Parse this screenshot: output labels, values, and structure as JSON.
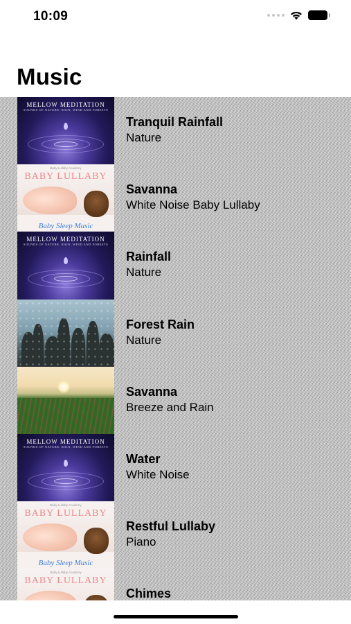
{
  "status_bar": {
    "time": "10:09"
  },
  "page": {
    "title": "Music"
  },
  "tracks": [
    {
      "title": "Tranquil Rainfall",
      "subtitle": "Nature",
      "art": "mellow-meditation"
    },
    {
      "title": "Savanna",
      "subtitle": "White Noise Baby Lullaby",
      "art": "baby-lullaby"
    },
    {
      "title": "Rainfall",
      "subtitle": "Nature",
      "art": "mellow-meditation"
    },
    {
      "title": "Forest Rain",
      "subtitle": "Nature",
      "art": "forest-rain"
    },
    {
      "title": "Savanna",
      "subtitle": "Breeze and Rain",
      "art": "sunrise-field"
    },
    {
      "title": "Water",
      "subtitle": "White Noise",
      "art": "mellow-meditation"
    },
    {
      "title": "Restful Lullaby",
      "subtitle": "Piano",
      "art": "baby-lullaby"
    },
    {
      "title": "Chimes",
      "subtitle": "",
      "art": "baby-lullaby"
    }
  ],
  "art_text": {
    "meditation_title": "MELLOW MEDITATION",
    "meditation_sub": "SOUNDS OF NATURE: RAIN, WIND AND FORESTS",
    "lullaby_top": "Baby Lullaby Academy",
    "lullaby_title": "BABY LULLABY",
    "lullaby_footer": "Baby Sleep Music"
  }
}
